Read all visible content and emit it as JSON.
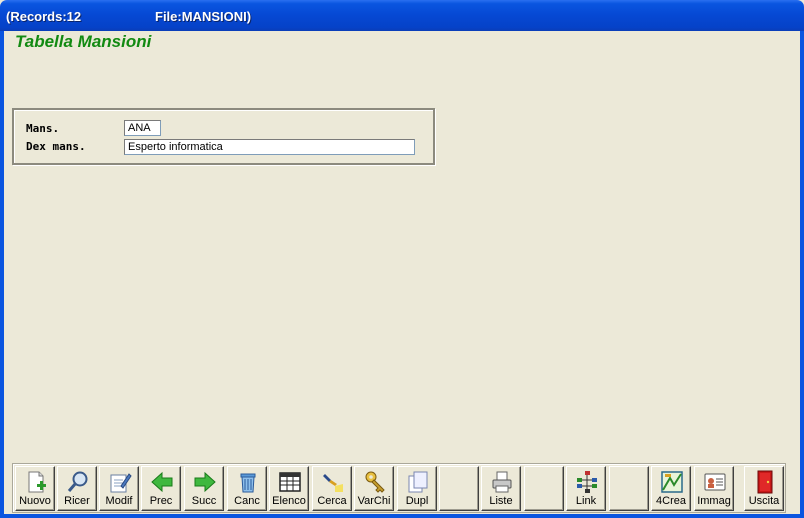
{
  "window": {
    "title_left": "(Records:12",
    "title_right": "File:MANSIONI)"
  },
  "page": {
    "title": "Tabella Mansioni"
  },
  "form": {
    "mans": {
      "label": "Mans.",
      "value": "ANA"
    },
    "dex": {
      "label": "Dex mans.",
      "value": "Esperto informatica"
    }
  },
  "toolbar": {
    "nuovo": "Nuovo",
    "ricer": "Ricer",
    "modif": "Modif",
    "prec": "Prec",
    "succ": "Succ",
    "canc": "Canc",
    "elenco": "Elenco",
    "cerca": "Cerca",
    "varchi": "VarChi",
    "dupl": "Dupl",
    "liste": "Liste",
    "link": "Link",
    "crea4": "4Crea",
    "immag": "Immag",
    "uscita": "Uscita"
  },
  "colors": {
    "title_bar": "#0648d3",
    "page_title": "#128a12",
    "background": "#ECE9D8"
  }
}
